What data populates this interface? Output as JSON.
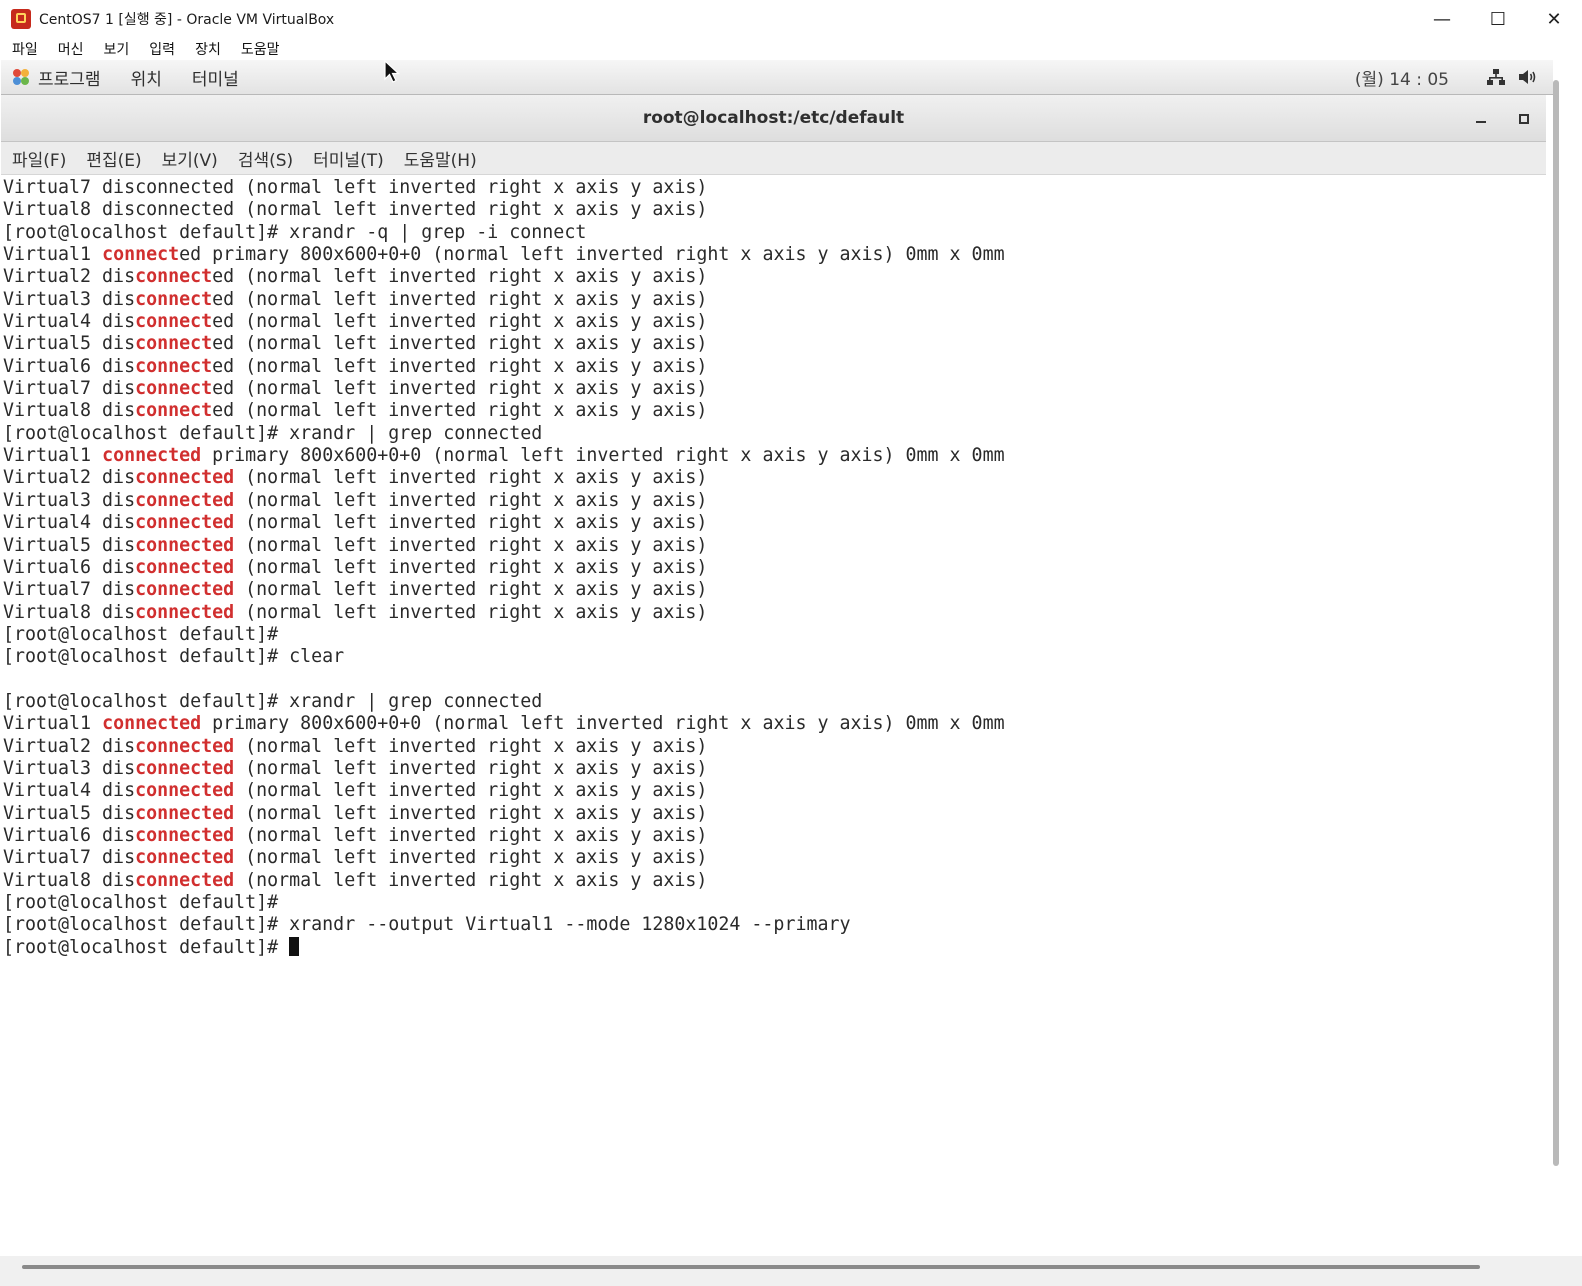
{
  "host_window": {
    "title": "CentOS7 1 [실행 중] - Oracle VM VirtualBox",
    "controls": {
      "minimize": "—",
      "maximize": "☐",
      "close": "✕"
    }
  },
  "vbox_menu": [
    "파일",
    "머신",
    "보기",
    "입력",
    "장치",
    "도움말"
  ],
  "gnome_panel": {
    "apps": "프로그램",
    "places": "위치",
    "terminal": "터미널",
    "clock": "(월) 14 : 05",
    "icons": [
      "network-icon",
      "volume-icon"
    ]
  },
  "terminal": {
    "title": "root@localhost:/etc/default",
    "menu": [
      "파일(F)",
      "편집(E)",
      "보기(V)",
      "검색(S)",
      "터미널(T)",
      "도움말(H)"
    ],
    "highlight_color": "#d12f2f",
    "lines": [
      [
        {
          "t": "Virtual7 disconnected (normal left inverted right x axis y axis)"
        }
      ],
      [
        {
          "t": "Virtual8 disconnected (normal left inverted right x axis y axis)"
        }
      ],
      [
        {
          "t": "[root@localhost default]# xrandr -q | grep -i connect"
        }
      ],
      [
        {
          "t": "Virtual1 "
        },
        {
          "t": "connect",
          "h": true
        },
        {
          "t": "ed primary 800x600+0+0 (normal left inverted right x axis y axis) 0mm x 0mm"
        }
      ],
      [
        {
          "t": "Virtual2 dis"
        },
        {
          "t": "connect",
          "h": true
        },
        {
          "t": "ed (normal left inverted right x axis y axis)"
        }
      ],
      [
        {
          "t": "Virtual3 dis"
        },
        {
          "t": "connect",
          "h": true
        },
        {
          "t": "ed (normal left inverted right x axis y axis)"
        }
      ],
      [
        {
          "t": "Virtual4 dis"
        },
        {
          "t": "connect",
          "h": true
        },
        {
          "t": "ed (normal left inverted right x axis y axis)"
        }
      ],
      [
        {
          "t": "Virtual5 dis"
        },
        {
          "t": "connect",
          "h": true
        },
        {
          "t": "ed (normal left inverted right x axis y axis)"
        }
      ],
      [
        {
          "t": "Virtual6 dis"
        },
        {
          "t": "connect",
          "h": true
        },
        {
          "t": "ed (normal left inverted right x axis y axis)"
        }
      ],
      [
        {
          "t": "Virtual7 dis"
        },
        {
          "t": "connect",
          "h": true
        },
        {
          "t": "ed (normal left inverted right x axis y axis)"
        }
      ],
      [
        {
          "t": "Virtual8 dis"
        },
        {
          "t": "connect",
          "h": true
        },
        {
          "t": "ed (normal left inverted right x axis y axis)"
        }
      ],
      [
        {
          "t": "[root@localhost default]# xrandr | grep connected"
        }
      ],
      [
        {
          "t": "Virtual1 "
        },
        {
          "t": "connected",
          "h": true
        },
        {
          "t": " primary 800x600+0+0 (normal left inverted right x axis y axis) 0mm x 0mm"
        }
      ],
      [
        {
          "t": "Virtual2 dis"
        },
        {
          "t": "connected",
          "h": true
        },
        {
          "t": " (normal left inverted right x axis y axis)"
        }
      ],
      [
        {
          "t": "Virtual3 dis"
        },
        {
          "t": "connected",
          "h": true
        },
        {
          "t": " (normal left inverted right x axis y axis)"
        }
      ],
      [
        {
          "t": "Virtual4 dis"
        },
        {
          "t": "connected",
          "h": true
        },
        {
          "t": " (normal left inverted right x axis y axis)"
        }
      ],
      [
        {
          "t": "Virtual5 dis"
        },
        {
          "t": "connected",
          "h": true
        },
        {
          "t": " (normal left inverted right x axis y axis)"
        }
      ],
      [
        {
          "t": "Virtual6 dis"
        },
        {
          "t": "connected",
          "h": true
        },
        {
          "t": " (normal left inverted right x axis y axis)"
        }
      ],
      [
        {
          "t": "Virtual7 dis"
        },
        {
          "t": "connected",
          "h": true
        },
        {
          "t": " (normal left inverted right x axis y axis)"
        }
      ],
      [
        {
          "t": "Virtual8 dis"
        },
        {
          "t": "connected",
          "h": true
        },
        {
          "t": " (normal left inverted right x axis y axis)"
        }
      ],
      [
        {
          "t": "[root@localhost default]#"
        }
      ],
      [
        {
          "t": "[root@localhost default]# clear"
        }
      ],
      [
        {
          "t": ""
        }
      ],
      [
        {
          "t": "[root@localhost default]# xrandr | grep connected"
        }
      ],
      [
        {
          "t": "Virtual1 "
        },
        {
          "t": "connected",
          "h": true
        },
        {
          "t": " primary 800x600+0+0 (normal left inverted right x axis y axis) 0mm x 0mm"
        }
      ],
      [
        {
          "t": "Virtual2 dis"
        },
        {
          "t": "connected",
          "h": true
        },
        {
          "t": " (normal left inverted right x axis y axis)"
        }
      ],
      [
        {
          "t": "Virtual3 dis"
        },
        {
          "t": "connected",
          "h": true
        },
        {
          "t": " (normal left inverted right x axis y axis)"
        }
      ],
      [
        {
          "t": "Virtual4 dis"
        },
        {
          "t": "connected",
          "h": true
        },
        {
          "t": " (normal left inverted right x axis y axis)"
        }
      ],
      [
        {
          "t": "Virtual5 dis"
        },
        {
          "t": "connected",
          "h": true
        },
        {
          "t": " (normal left inverted right x axis y axis)"
        }
      ],
      [
        {
          "t": "Virtual6 dis"
        },
        {
          "t": "connected",
          "h": true
        },
        {
          "t": " (normal left inverted right x axis y axis)"
        }
      ],
      [
        {
          "t": "Virtual7 dis"
        },
        {
          "t": "connected",
          "h": true
        },
        {
          "t": " (normal left inverted right x axis y axis)"
        }
      ],
      [
        {
          "t": "Virtual8 dis"
        },
        {
          "t": "connected",
          "h": true
        },
        {
          "t": " (normal left inverted right x axis y axis)"
        }
      ],
      [
        {
          "t": "[root@localhost default]#"
        }
      ],
      [
        {
          "t": "[root@localhost default]# xrandr --output Virtual1 --mode 1280x1024 --primary"
        }
      ],
      [
        {
          "t": "[root@localhost default]# "
        },
        {
          "cursor": true
        }
      ]
    ]
  }
}
